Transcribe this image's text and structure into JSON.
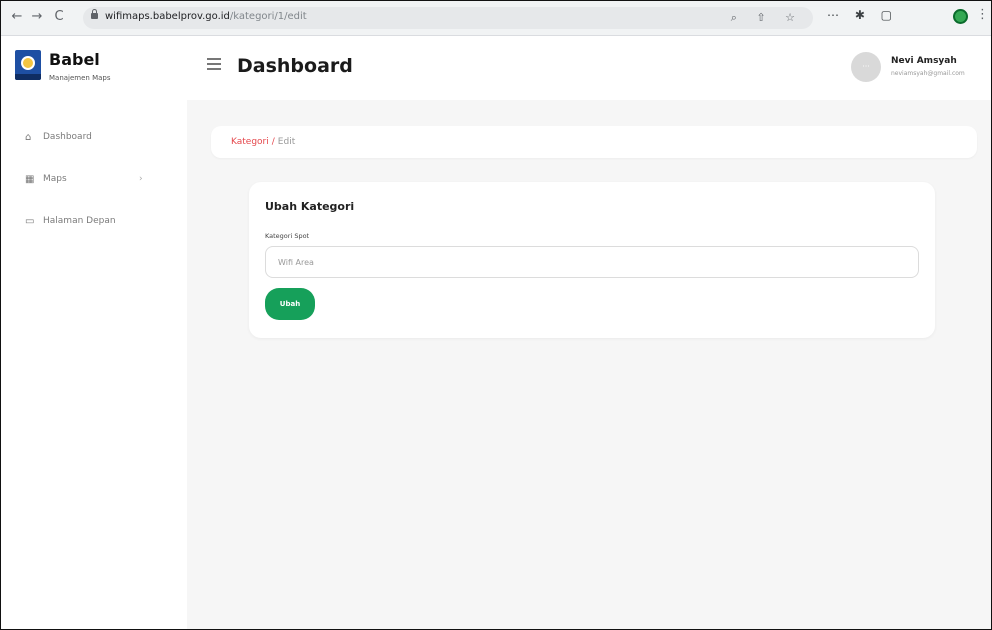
{
  "browser": {
    "back_icon": "←",
    "forward_icon": "→",
    "reload_icon": "C",
    "url_host": "wifimaps.babelprov.go.id",
    "url_path": "/kategori/1/edit",
    "omnibox_icons": "⌕ ⇧ ☆",
    "extension_icons": "⋯ ✱ ▢",
    "menu_icon": "⋮"
  },
  "sidebar": {
    "brand": "Babel",
    "brand_sub": "Manajemen Maps",
    "items": [
      {
        "label": "Dashboard",
        "icon": "⌂"
      },
      {
        "label": "Maps",
        "icon": "▦",
        "chevron": "›"
      },
      {
        "label": "Halaman Depan",
        "icon": "▭"
      }
    ]
  },
  "header": {
    "title": "Dashboard",
    "avatar_text": "···",
    "user_name": "Nevi Amsyah",
    "user_email": "neviamsyah@gmail.com"
  },
  "breadcrumb": {
    "parent": "Kategori",
    "separator": "/",
    "current": "Edit"
  },
  "form": {
    "title": "Ubah Kategori",
    "label": "Kategori Spot",
    "input_value": "",
    "input_placeholder": "Wifi Area",
    "submit_label": "Ubah"
  },
  "colors": {
    "accent_green": "#16a05a",
    "breadcrumb_red": "#e5484d",
    "content_bg": "#f6f6f6"
  }
}
